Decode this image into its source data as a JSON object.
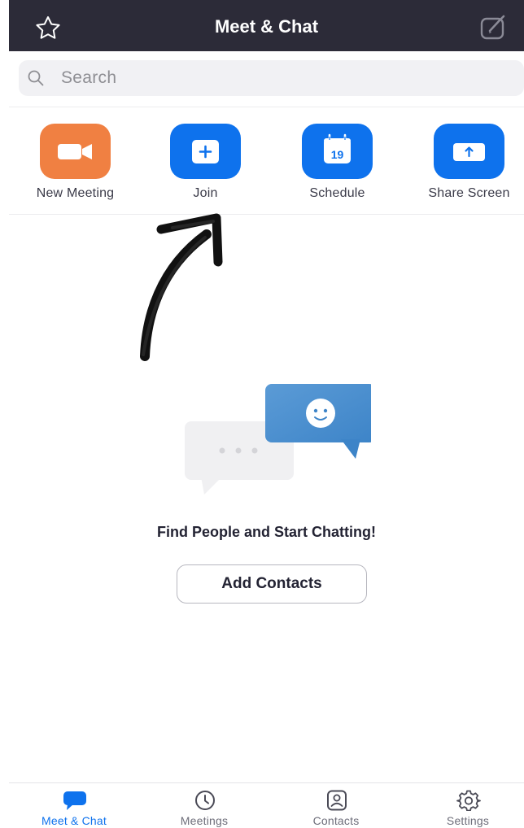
{
  "header": {
    "title": "Meet & Chat",
    "star_icon": "star-icon",
    "compose_icon": "compose-icon",
    "background": "#2c2b38"
  },
  "search": {
    "placeholder": "Search",
    "icon": "search-icon"
  },
  "actions": [
    {
      "label": "New Meeting",
      "icon": "video-camera-icon",
      "color": "#f08042"
    },
    {
      "label": "Join",
      "icon": "plus-icon",
      "color": "#0e72ed"
    },
    {
      "label": "Schedule",
      "icon": "calendar-icon",
      "calendar_day": "19",
      "color": "#0e72ed"
    },
    {
      "label": "Share Screen",
      "icon": "share-upload-icon",
      "color": "#0e72ed"
    }
  ],
  "annotation": {
    "icon": "hand-drawn-arrow-icon"
  },
  "empty_state": {
    "title": "Find People and Start Chatting!",
    "button_label": "Add Contacts",
    "illustration_icon": "chat-bubbles-illustration-icon"
  },
  "tabbar": {
    "active_color": "#0e72ed",
    "items": [
      {
        "label": "Meet & Chat",
        "icon": "chat-bubble-icon",
        "active": true
      },
      {
        "label": "Meetings",
        "icon": "clock-icon",
        "active": false
      },
      {
        "label": "Contacts",
        "icon": "contact-card-icon",
        "active": false
      },
      {
        "label": "Settings",
        "icon": "gear-icon",
        "active": false
      }
    ]
  }
}
